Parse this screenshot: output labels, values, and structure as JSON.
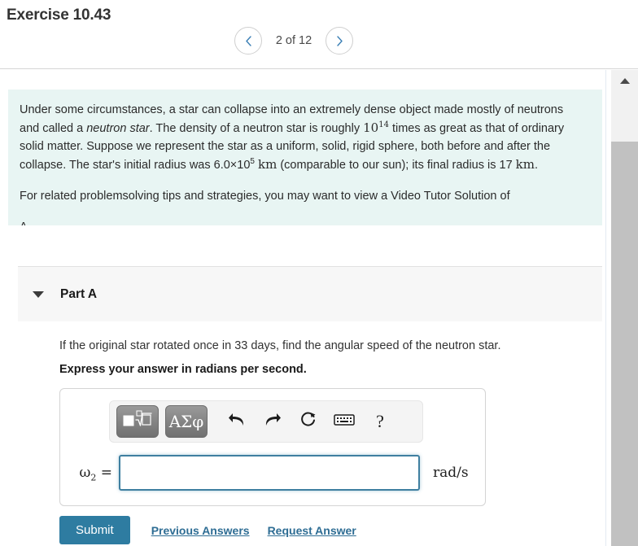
{
  "header": {
    "exercise_title": "Exercise 10.43",
    "prev_icon": "chevron-left-icon",
    "next_icon": "chevron-right-icon",
    "pager_text": "2 of 12",
    "current_page": 2,
    "total_pages": 12
  },
  "problem": {
    "background_color": "#e8f5f3",
    "paragraph1_a": "Under some circumstances, a star can collapse into an extremely dense object made mostly of neutrons and called a ",
    "paragraph1_italic": "neutron star",
    "paragraph1_b": ". The density of a neutron star is roughly ",
    "density_base": "10",
    "density_exp": "14",
    "paragraph1_c": " times as great as that of ordinary solid matter. Suppose we represent the star as a uniform, solid, rigid sphere, both before and after the collapse. The star's initial radius was 6.0×10",
    "initial_radius_exp": "5",
    "unit_km_1": "km",
    "paragraph1_d": " (comparable to our sun); its final radius is 17 ",
    "unit_km_2": "km",
    "paragraph1_e": ".",
    "paragraph2": "For related problemsolving tips and strategies, you may want to view a Video Tutor Solution of",
    "paragraph3_clipped": "A"
  },
  "part": {
    "caret_icon": "caret-down-icon",
    "label": "Part A",
    "question": "If the original star rotated once in 33 days, find the angular speed of the neutron star.",
    "instruction": "Express your answer in radians per second."
  },
  "answer": {
    "toolbar": {
      "template_button": {
        "name": "math-template-button",
        "icon": "square-nth-root-icon"
      },
      "greek_button": {
        "name": "greek-symbols-button",
        "label": "ΑΣφ"
      },
      "undo": {
        "name": "undo-icon",
        "label": "undo"
      },
      "redo": {
        "name": "redo-icon",
        "label": "redo"
      },
      "reset": {
        "name": "reset-icon",
        "label": "reset"
      },
      "keyboard": {
        "name": "keyboard-icon",
        "label": "keyboard"
      },
      "help": {
        "name": "help-icon",
        "label": "?"
      }
    },
    "variable_base": "ω",
    "variable_sub": "2",
    "equals": " =",
    "input_value": "",
    "input_placeholder": "",
    "input_focused": true,
    "input_border_color": "#3f7fa0",
    "unit": "rad/s"
  },
  "actions": {
    "submit_label": "Submit",
    "submit_color": "#2e7ca1",
    "previous_answers_label": "Previous Answers",
    "request_answer_label": "Request Answer",
    "link_color": "#2e6d94"
  },
  "scrollbar": {
    "up_arrow_icon": "scroll-up-arrow-icon",
    "thumb_color": "#c1c1c1",
    "track_color": "#f1f1f1"
  }
}
